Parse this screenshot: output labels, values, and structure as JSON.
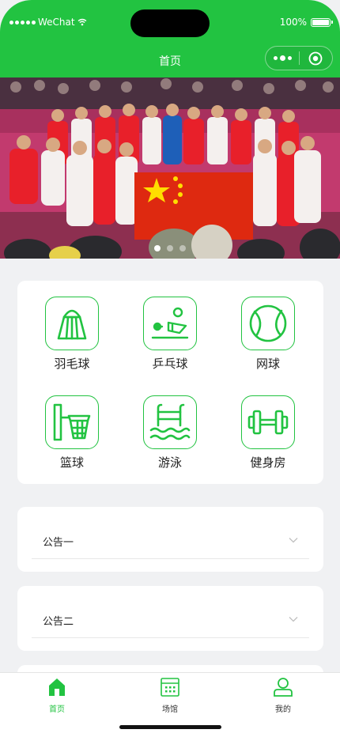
{
  "status_bar": {
    "carrier": "WeChat",
    "battery_text": "100%",
    "battery_level": 1.0
  },
  "nav": {
    "title": "首页"
  },
  "banner": {
    "slide_count": 3,
    "active_slide": 1
  },
  "categories": [
    {
      "label": "羽毛球",
      "icon": "shuttlecock-icon"
    },
    {
      "label": "乒乓球",
      "icon": "ping-pong-icon"
    },
    {
      "label": "网球",
      "icon": "tennis-ball-icon"
    },
    {
      "label": "篮球",
      "icon": "basketball-icon"
    },
    {
      "label": "游泳",
      "icon": "swimming-pool-icon"
    },
    {
      "label": "健身房",
      "icon": "dumbbell-icon"
    }
  ],
  "notices": [
    {
      "title": "公告一"
    },
    {
      "title": "公告二"
    }
  ],
  "tabbar": {
    "items": [
      {
        "label": "首页",
        "icon": "home-icon",
        "active": true
      },
      {
        "label": "场馆",
        "icon": "venue-calendar-icon",
        "active": false
      },
      {
        "label": "我的",
        "icon": "user-icon",
        "active": false
      }
    ]
  },
  "colors": {
    "brand": "#22c341",
    "background": "#f0f1f3"
  }
}
